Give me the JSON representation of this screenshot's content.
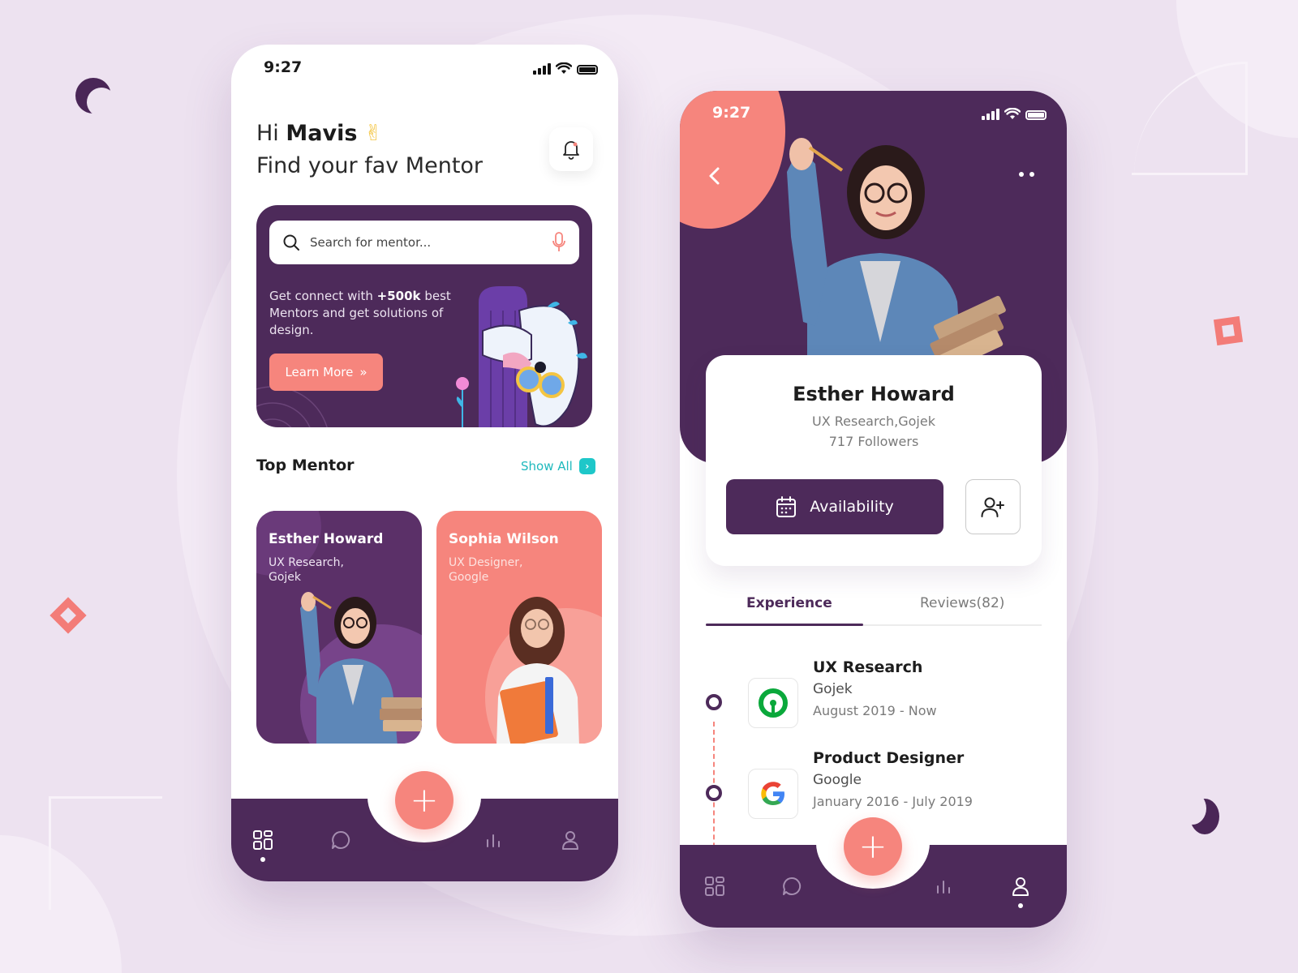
{
  "phone1": {
    "status": {
      "time": "9:27"
    },
    "greeting": {
      "hi": "Hi",
      "name": "Mavis",
      "emoji": "✌",
      "subtitle": "Find your fav Mentor"
    },
    "search": {
      "placeholder": "Search for mentor..."
    },
    "promo": {
      "text_before": "Get connect with",
      "highlight": "+500k",
      "text_after": "best Mentors and get solutions of design.",
      "button_label": "Learn More",
      "button_icon": "»"
    },
    "top_mentor": {
      "title": "Top Mentor",
      "show_all": "Show All"
    },
    "mentors": [
      {
        "name": "Esther Howard",
        "role_line1": "UX Research,",
        "role_line2": "Gojek"
      },
      {
        "name": "Sophia Wilson",
        "role_line1": "UX Designer,",
        "role_line2": "Google"
      }
    ],
    "nav": {
      "fab_label": "+"
    }
  },
  "phone2": {
    "status": {
      "time": "9:27"
    },
    "profile": {
      "name": "Esther Howard",
      "role": "UX Research,Gojek",
      "followers": "717 Followers",
      "availability_label": "Availability"
    },
    "tabs": [
      {
        "label": "Experience",
        "active": true
      },
      {
        "label": "Reviews(82)",
        "active": false
      }
    ],
    "experience": [
      {
        "title": "UX Research",
        "company": "Gojek",
        "dates": "August 2019 - Now",
        "logo": "gojek-logo"
      },
      {
        "title": "Product Designer",
        "company": "Google",
        "dates": "January 2016 - July 2019",
        "logo": "google-logo"
      }
    ],
    "nav": {
      "fab_label": "+"
    }
  },
  "colors": {
    "background": "#ede2f0",
    "primary": "#4d2a5a",
    "accent": "#f6857d",
    "teal": "#1ec7c9"
  }
}
